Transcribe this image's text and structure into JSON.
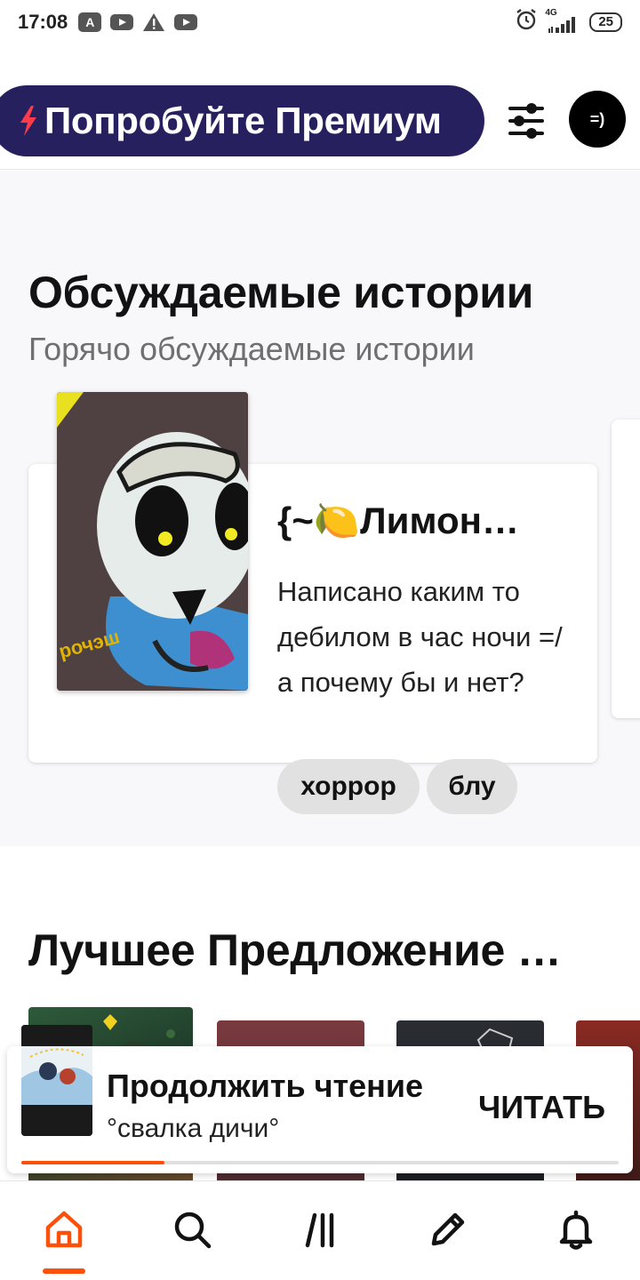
{
  "status_bar": {
    "time": "17:08",
    "network": "4G",
    "battery": "25",
    "notification_icons": [
      "a-app-icon",
      "youtube-icon",
      "warning-icon",
      "youtube-icon"
    ]
  },
  "header": {
    "premium_label": "Попробуйте Премиум",
    "avatar_text": "=)"
  },
  "discussed": {
    "title": "Обсуждаемые истории",
    "subtitle": "Горячо обсуждаемые истории",
    "story": {
      "cover_text": "рочэш",
      "title": "{~🍋Лимон…",
      "description": "Написано каким то дебилом в час ночи =/ а почему бы и нет?",
      "tags": [
        "хоррор",
        "блу"
      ]
    }
  },
  "best_offer": {
    "title": "Лучшее Предложение …"
  },
  "continue_reading": {
    "heading": "Продолжить чтение",
    "story_title": "°свалка дичи°",
    "read_button": "ЧИТАТЬ",
    "progress": 0.24
  },
  "bottom_nav": {
    "items": [
      "home-icon",
      "search-icon",
      "library-icon",
      "write-icon",
      "notifications-icon"
    ],
    "active": "home-icon"
  },
  "colors": {
    "accent": "#ff500a",
    "premium_bg": "#26205f",
    "premium_bolt": "#ff3b4a",
    "section_bg": "#f8f7f9"
  }
}
